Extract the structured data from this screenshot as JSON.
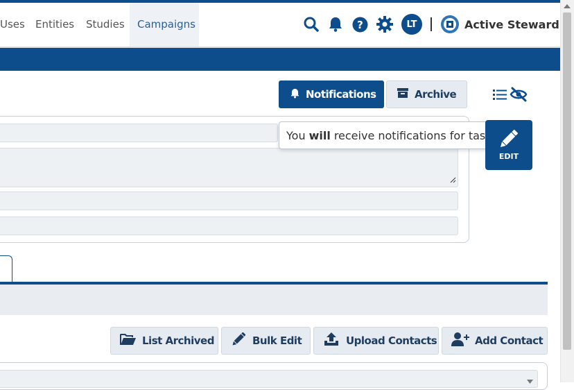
{
  "nav": {
    "items": [
      {
        "label": "Uses",
        "active": false
      },
      {
        "label": "Entities",
        "active": false
      },
      {
        "label": "Studies",
        "active": false
      },
      {
        "label": "Campaigns",
        "active": true
      }
    ],
    "icons": [
      "search-icon",
      "bell-icon",
      "help-icon",
      "gear-icon"
    ],
    "avatar_initials": "LT",
    "brand_name": "Active Steward"
  },
  "toolbar": {
    "notifications_label": "Notifications",
    "archive_label": "Archive",
    "view_icons": [
      "list-icon",
      "eye-slash-icon"
    ]
  },
  "tooltip": {
    "prefix": "You",
    "emphasis": "will",
    "suffix": "receive notifications for tasks"
  },
  "edit_button": {
    "label": "EDIT"
  },
  "actions": {
    "list_archived": "List Archived",
    "bulk_edit": "Bulk Edit",
    "upload_contacts": "Upload Contacts",
    "add_contact": "Add Contact"
  },
  "colors": {
    "brand": "#0d4d8c",
    "light_button": "#e6ebf1",
    "field_bg": "#eef1f4",
    "nav_active_bg": "#eef1f5"
  }
}
